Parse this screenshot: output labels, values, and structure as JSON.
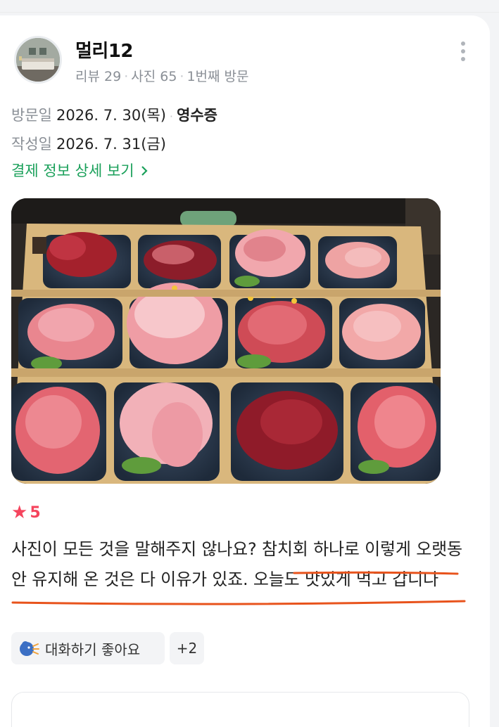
{
  "review": {
    "author": {
      "name": "멀리12",
      "reviews": "리뷰 29",
      "photos": "사진 65",
      "visit_count": "1번째 방문"
    },
    "visit_label": "방문일",
    "visit_date": "2026. 7. 30(목)",
    "verify_badge": "영수증",
    "written_label": "작성일",
    "written_date": "2026. 7. 31(금)",
    "payment_link": "결제 정보 상세 보기",
    "rating": "5",
    "text": {
      "plain": "사진이 모든 것을 말해주지 않나요? ",
      "highlighted": "참치회 하나로 이렇게 오랫동안 유지해 온 것은 다 이유가 있죠. 오늘도 맛있게 먹고 갑니다"
    },
    "tags": {
      "first": "대화하기 좋아요",
      "extra": "+2"
    }
  },
  "colors": {
    "accent_green": "#1aa05a",
    "star_red": "#f5445d",
    "underline_orange": "#e8531c"
  },
  "icons": {
    "more": "more-vertical-icon",
    "star": "star-icon",
    "chevron": "chevron-right-icon",
    "talk": "speaking-head-icon"
  }
}
